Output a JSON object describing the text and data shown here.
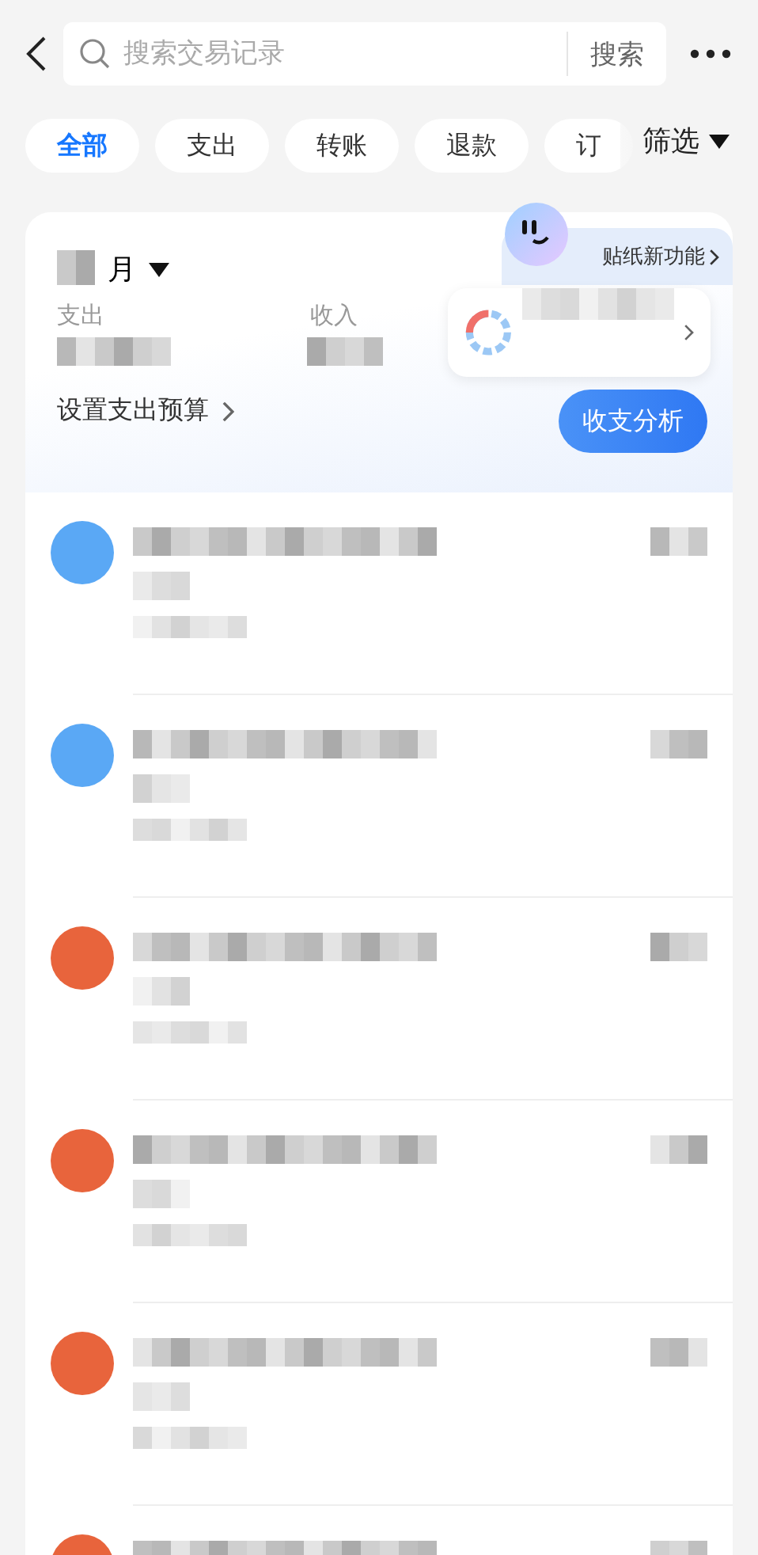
{
  "header": {
    "search": {
      "placeholder": "搜索交易记录",
      "button": "搜索"
    }
  },
  "chips": [
    {
      "label": "全部",
      "selected": true
    },
    {
      "label": "支出",
      "selected": false
    },
    {
      "label": "转账",
      "selected": false
    },
    {
      "label": "退款",
      "selected": false
    },
    {
      "label": "订",
      "selected": false
    }
  ],
  "filter": "筛选",
  "summary": {
    "month": "月",
    "expense_label": "支出",
    "income_label": "收入",
    "budget_link": "设置支出预算",
    "analysis_button": "收支分析",
    "sticker_badge": "贴纸新功能"
  },
  "transactions": [
    {
      "color": "#5aa8f5"
    },
    {
      "color": "#5aa8f5"
    },
    {
      "color": "#e8643c"
    },
    {
      "color": "#e8643c"
    },
    {
      "color": "#e8643c"
    },
    {
      "color": "#e8643c"
    }
  ]
}
